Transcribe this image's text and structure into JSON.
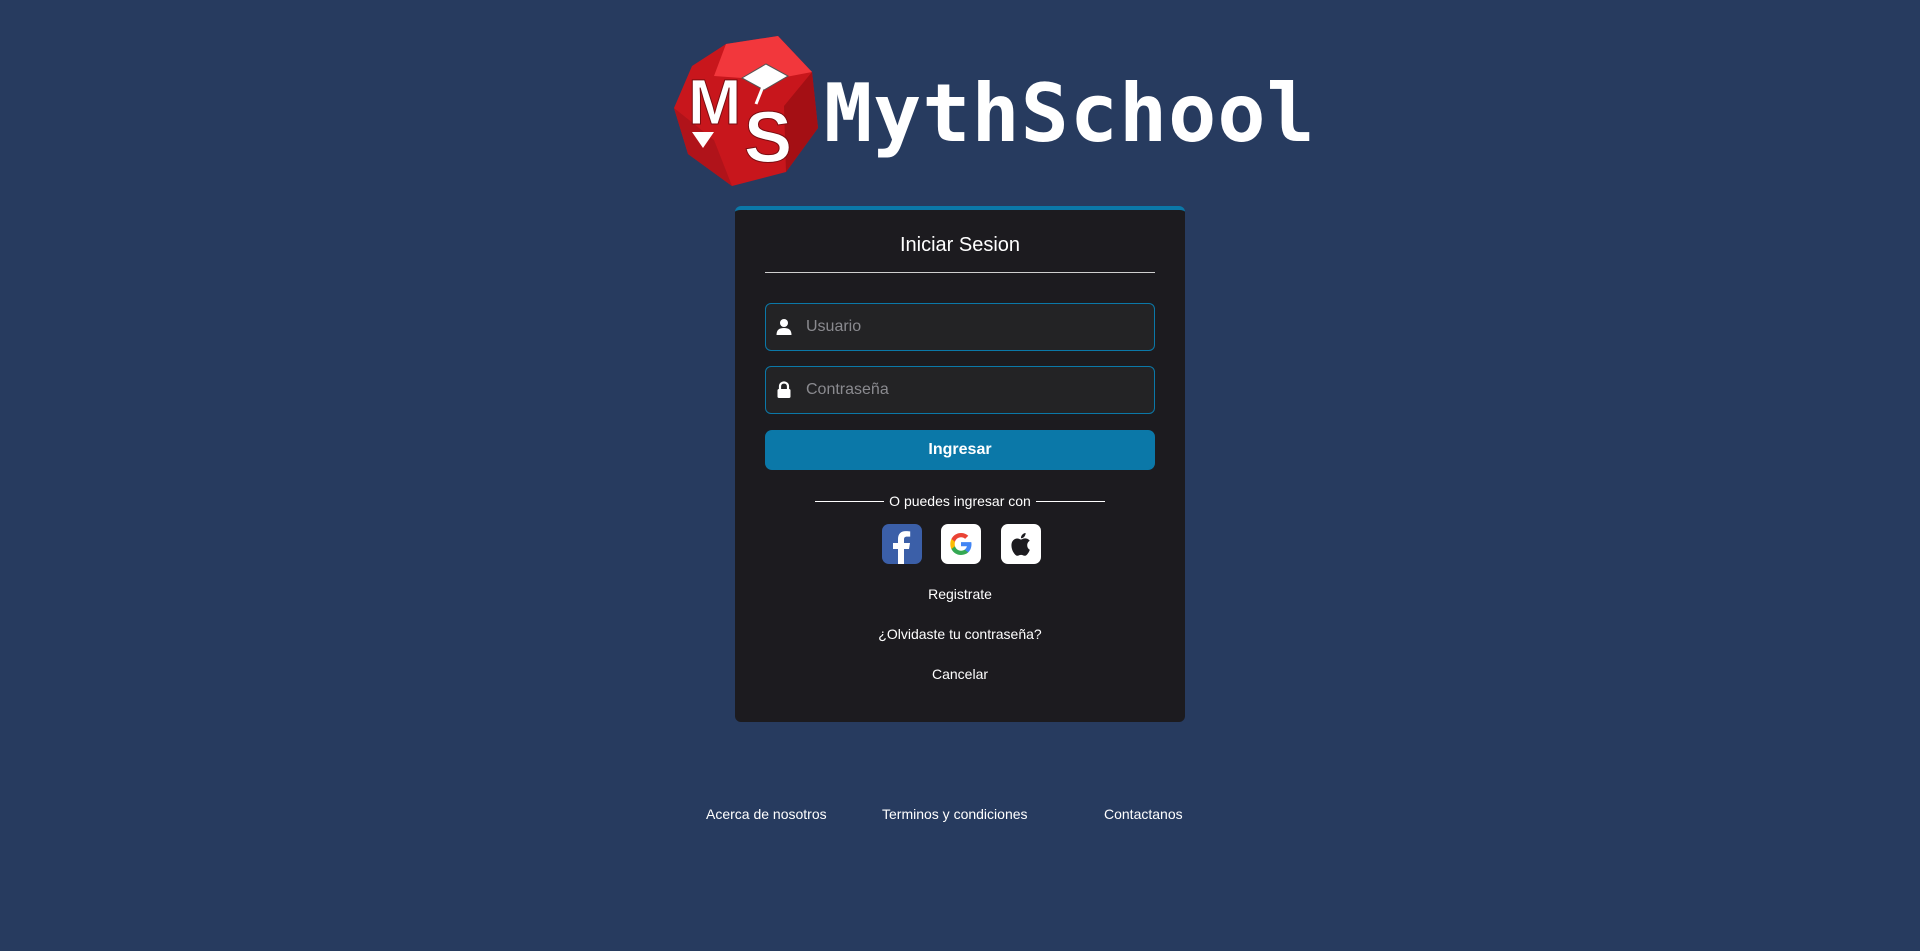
{
  "brand": {
    "logo_text": "MythSchool",
    "logo_mark_name": "mythschool-logo-mark"
  },
  "login": {
    "title": "Iniciar Sesion",
    "username": {
      "placeholder": "Usuario",
      "value": "",
      "icon": "user-icon"
    },
    "password": {
      "placeholder": "Contraseña",
      "value": "",
      "icon": "lock-icon"
    },
    "submit_label": "Ingresar",
    "divider_text": "O puedes ingresar con",
    "social": [
      {
        "name": "facebook",
        "icon": "facebook-icon",
        "color": "#3b5fa8"
      },
      {
        "name": "google",
        "icon": "google-icon",
        "color": "#ffffff"
      },
      {
        "name": "apple",
        "icon": "apple-icon",
        "color": "#ffffff"
      }
    ],
    "register_label": "Registrate",
    "forgot_label": "¿Olvidaste tu contraseña?",
    "cancel_label": "Cancelar"
  },
  "footer": {
    "about": "Acerca de nosotros",
    "terms": "Terminos y condiciones",
    "contact": "Contactanos"
  },
  "colors": {
    "background": "#273b5f",
    "card": "#1c1b1f",
    "accent": "#0b78a8",
    "logo_red": "#e02228"
  }
}
